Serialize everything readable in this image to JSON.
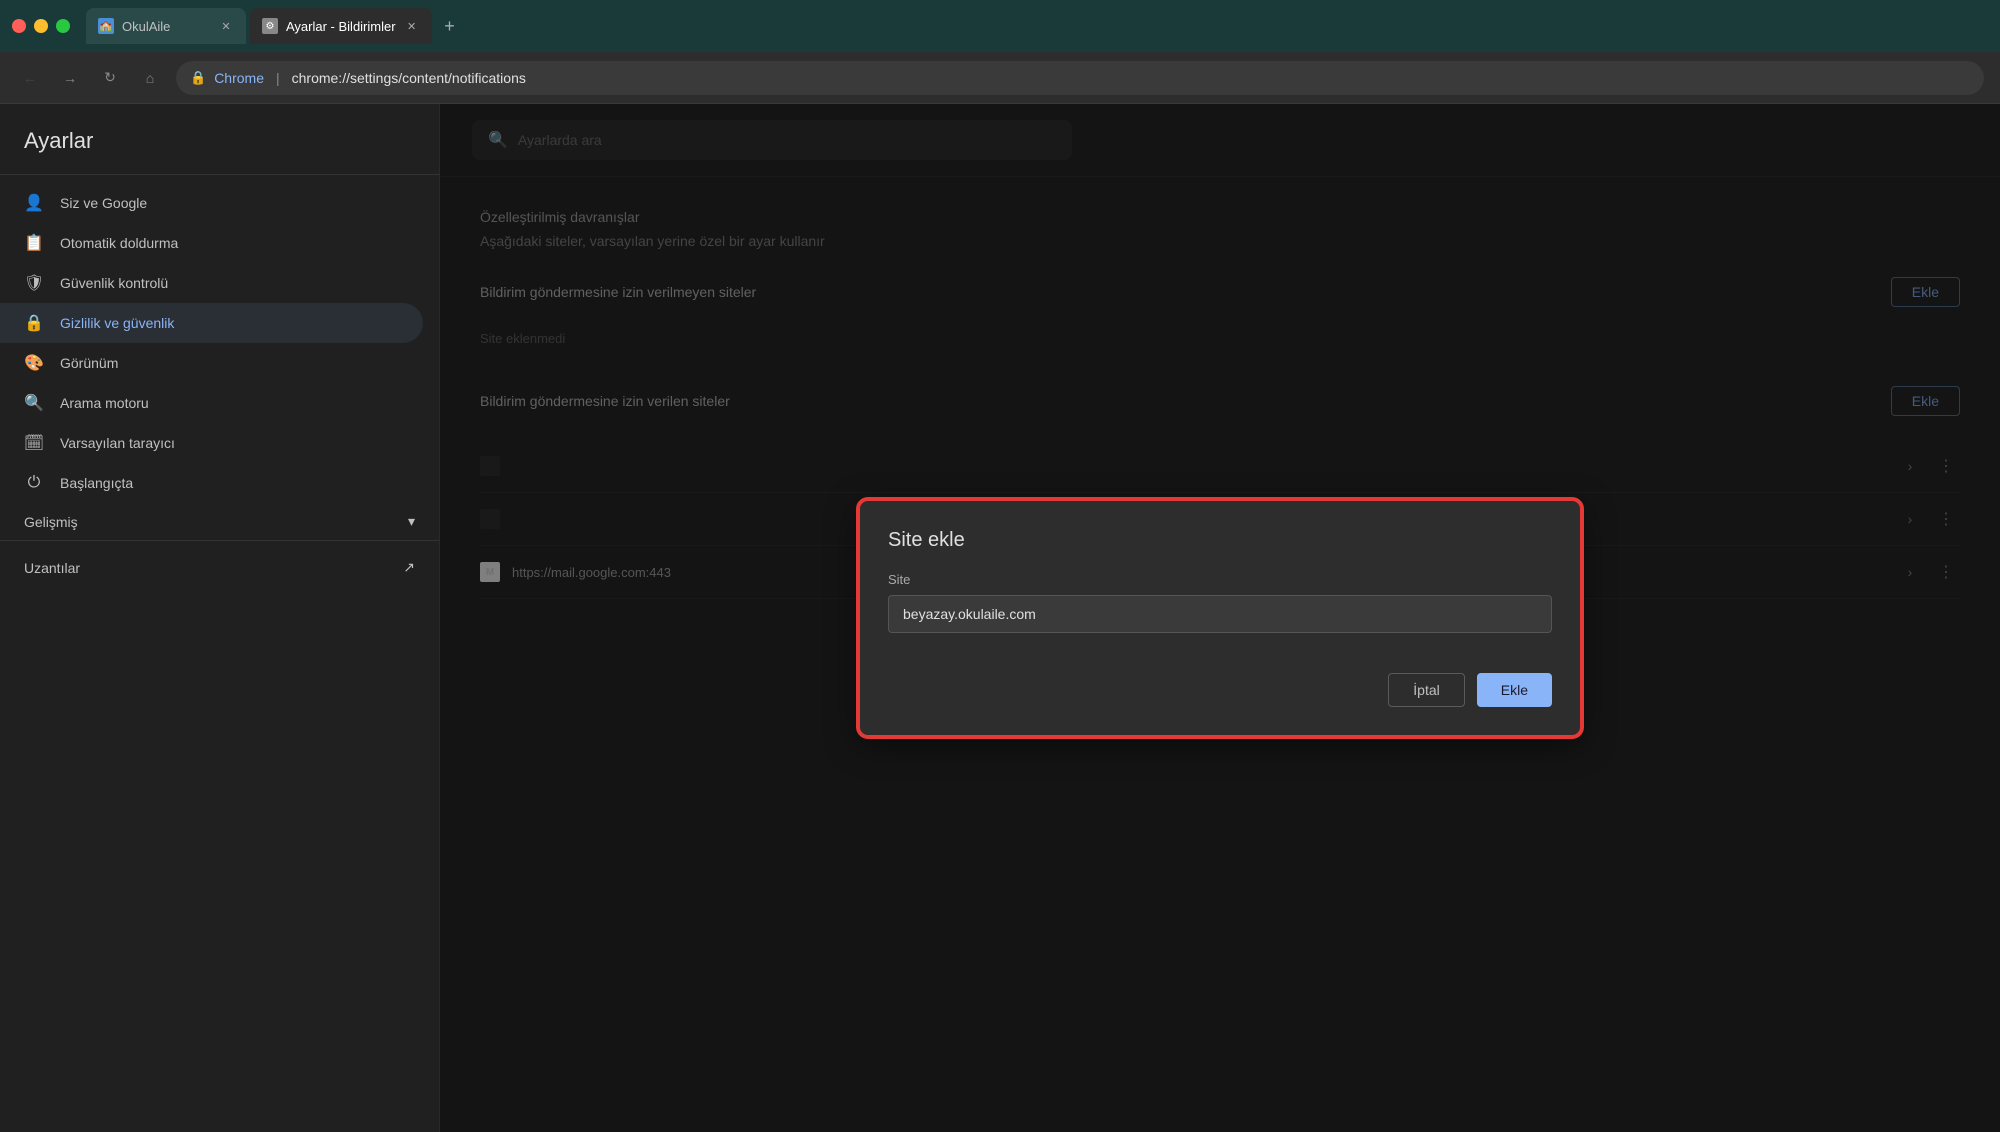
{
  "titlebar": {
    "tab1_title": "OkulAile",
    "tab2_title": "Ayarlar - Bildirimler",
    "new_tab_label": "+"
  },
  "addressbar": {
    "brand": "Chrome",
    "separator": "|",
    "url": "chrome://settings/content/notifications"
  },
  "sidebar": {
    "title": "Ayarlar",
    "search_placeholder": "Ayarlarda ara",
    "items": [
      {
        "id": "siz-ve-google",
        "label": "Siz ve Google",
        "icon": "👤"
      },
      {
        "id": "otomatik-doldurma",
        "label": "Otomatik doldurma",
        "icon": "📋"
      },
      {
        "id": "guvenlik-kontrolu",
        "label": "Güvenlik kontrolü",
        "icon": "🛡"
      },
      {
        "id": "gizlilik-ve-guvenlik",
        "label": "Gizlilik ve güvenlik",
        "icon": "🔒",
        "active": true
      },
      {
        "id": "gorunum",
        "label": "Görünüm",
        "icon": "🎨"
      },
      {
        "id": "arama-motoru",
        "label": "Arama motoru",
        "icon": "🔍"
      },
      {
        "id": "varsayilan-tarayici",
        "label": "Varsayılan tarayıcı",
        "icon": "🗓"
      },
      {
        "id": "baslangicta",
        "label": "Başlangıçta",
        "icon": "⏻"
      }
    ],
    "advanced_label": "Gelişmiş",
    "extensions_label": "Uzantılar"
  },
  "content": {
    "customized_section_title": "Özelleştirilmiş davranışlar",
    "customized_section_desc": "Aşağıdaki siteler, varsayılan yerine özel bir ayar kullanır",
    "blocked_section_title": "Bildirim göndermesine izin verilmeyen siteler",
    "blocked_add_btn": "Ekle",
    "no_sites_text": "Site eklenmedi",
    "allowed_section_title": "Bildirim göndermesine izin verilen siteler",
    "allowed_add_btn": "Ekle",
    "gmail_url": "https://mail.google.com:443"
  },
  "dialog": {
    "title": "Site ekle",
    "field_label": "Site",
    "input_value": "beyazay.okulaile.com",
    "input_placeholder": "beyazay.okulaile.com",
    "cancel_btn": "İptal",
    "add_btn": "Ekle"
  }
}
